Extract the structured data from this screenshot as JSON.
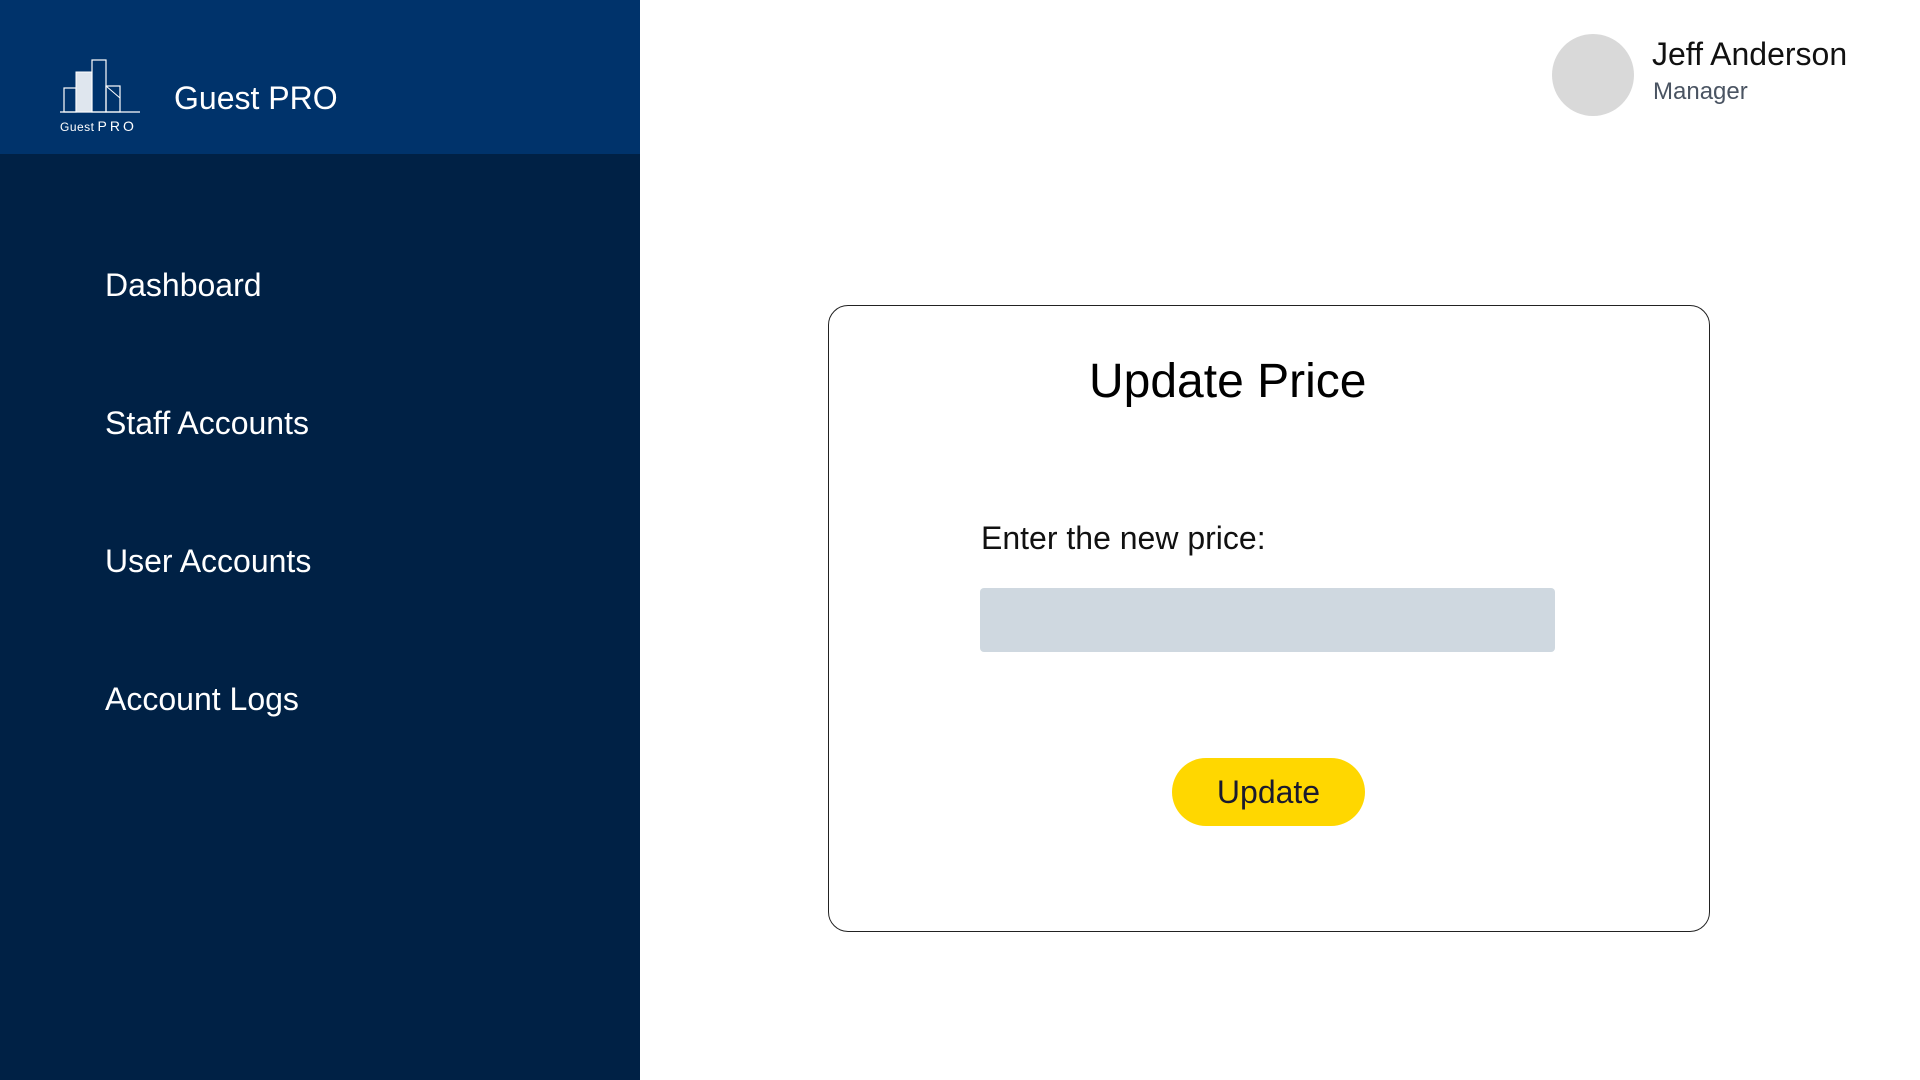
{
  "brand": {
    "logo_text_small": "Guest",
    "logo_text_pro": "PRO",
    "title": "Guest PRO"
  },
  "nav": {
    "items": [
      {
        "label": "Dashboard"
      },
      {
        "label": "Staff Accounts"
      },
      {
        "label": "User Accounts"
      },
      {
        "label": "Account Logs"
      }
    ]
  },
  "user": {
    "name": "Jeff Anderson",
    "role": "Manager"
  },
  "card": {
    "title": "Update Price",
    "field_label": "Enter the new price:",
    "input_value": "",
    "button_label": "Update"
  },
  "colors": {
    "sidebar": "#002145",
    "brand_bar": "#00336b",
    "button": "#ffd700",
    "input": "#cfd8e0"
  },
  "icons": {
    "logo": "buildings-logo-icon"
  }
}
